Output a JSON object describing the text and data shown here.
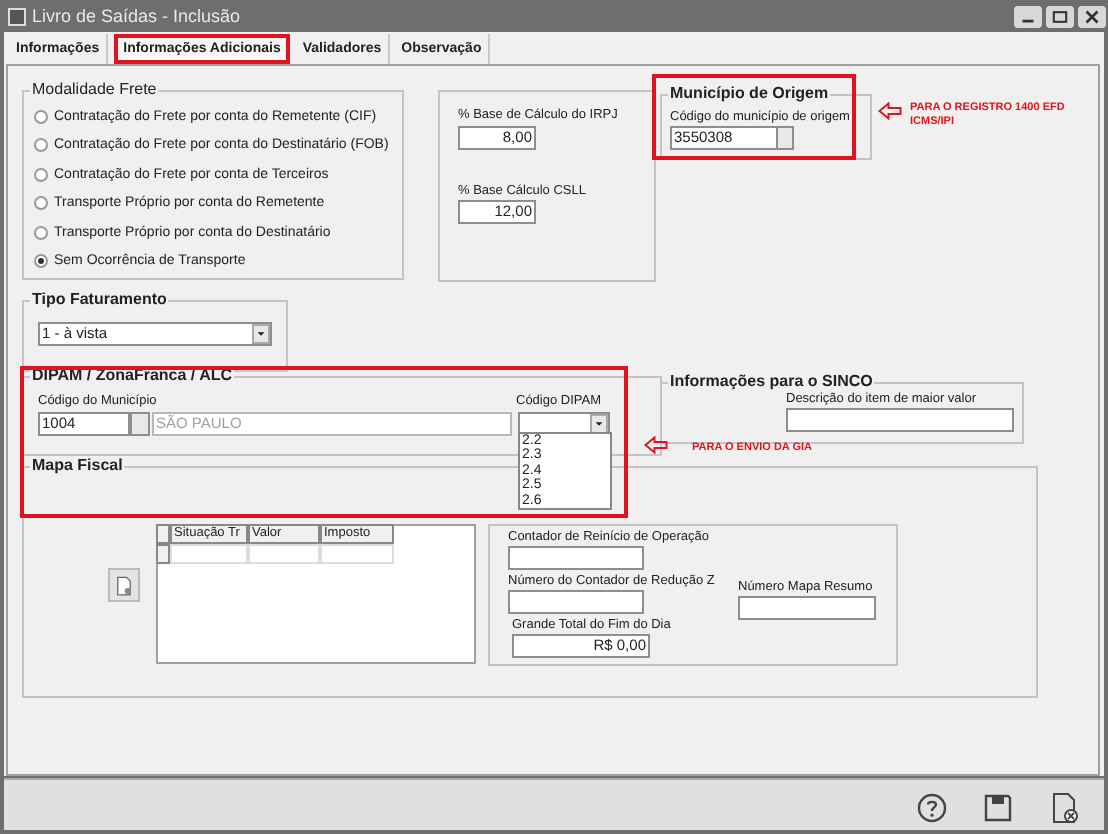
{
  "window": {
    "title": "Livro de Saídas - Inclusão"
  },
  "tabs": [
    {
      "label": "Informações",
      "selected": false
    },
    {
      "label": "Informações Adicionais",
      "selected": true
    },
    {
      "label": "Validadores",
      "selected": false
    },
    {
      "label": "Observação",
      "selected": false
    }
  ],
  "modalidade_frete": {
    "title": "Modalidade Frete",
    "options": [
      {
        "label": "Contratação do Frete por conta do Remetente (CIF)",
        "selected": false
      },
      {
        "label": "Contratação do Frete por conta do Destinatário (FOB)",
        "selected": false
      },
      {
        "label": "Contratação do Frete por conta de Terceiros",
        "selected": false
      },
      {
        "label": "Transporte Próprio por conta do Remetente",
        "selected": false
      },
      {
        "label": "Transporte Próprio por conta do Destinatário",
        "selected": false
      },
      {
        "label": "Sem Ocorrência de Transporte",
        "selected": true
      }
    ]
  },
  "bases": [
    {
      "label": "% Base de Cálculo do IRPJ",
      "value": "8,00"
    },
    {
      "label": "% Base Cálculo CSLL",
      "value": "12,00"
    }
  ],
  "municipio_origem": {
    "title": "Município de Origem",
    "label": "Código do município de origem",
    "value": "3550308"
  },
  "tipo_faturamento": {
    "title": "Tipo Faturamento",
    "value": "1 - à vista"
  },
  "dipam": {
    "title": "DIPAM / ZonaFranca / ALC",
    "municipio_label": "Código do Município",
    "municipio_code": "1004",
    "municipio_name": "SÃO PAULO",
    "dipam_label": "Código DIPAM",
    "dipam_options": [
      "2.2",
      "2.3",
      "2.4",
      "2.5",
      "2.6"
    ]
  },
  "sinco": {
    "title": "Informações para o SINCO",
    "label": "Descrição do item de maior valor"
  },
  "mapa_fiscal": {
    "title": "Mapa Fiscal",
    "columns": [
      "Situação Tr",
      "Valor",
      "Imposto"
    ],
    "fields": [
      {
        "label": "Contador de Reinício de Operação"
      },
      {
        "label": "Número do Contador de Redução Z"
      },
      {
        "label": "Número Mapa Resumo"
      },
      {
        "label": "Grande Total do Fim do Dia",
        "value": "R$ 0,00"
      }
    ]
  },
  "annotations": [
    {
      "text": "PARA O REGISTRO 1400 EFD ICMS/IPI"
    },
    {
      "text": "PARA O ENVIO DA GIA"
    }
  ]
}
